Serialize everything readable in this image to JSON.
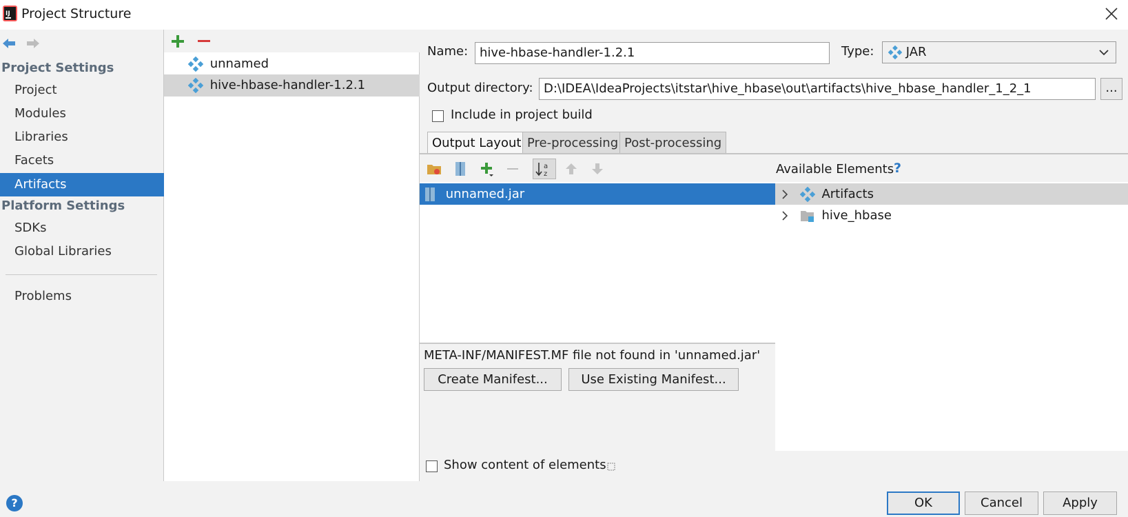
{
  "window": {
    "title": "Project Structure"
  },
  "sidebar": {
    "project_settings_header": "Project Settings",
    "project_items": [
      "Project",
      "Modules",
      "Libraries",
      "Facets",
      "Artifacts"
    ],
    "platform_settings_header": "Platform Settings",
    "platform_items": [
      "SDKs",
      "Global Libraries"
    ],
    "problems_label": "Problems",
    "selected": "Artifacts"
  },
  "artifacts_list": {
    "items": [
      "unnamed",
      "hive-hbase-handler-1.2.1"
    ],
    "selected": "hive-hbase-handler-1.2.1"
  },
  "form": {
    "name_label": "Name:",
    "name_value": "hive-hbase-handler-1.2.1",
    "type_label": "Type:",
    "type_value": "JAR",
    "output_dir_label": "Output directory:",
    "output_dir_value": "D:\\IDEA\\IdeaProjects\\itstar\\hive_hbase\\out\\artifacts\\hive_hbase_handler_1_2_1",
    "browse_label": "...",
    "include_label": "Include in project build",
    "include_checked": false
  },
  "tabs": [
    "Output Layout",
    "Pre-processing",
    "Post-processing"
  ],
  "active_tab": "Output Layout",
  "output_layout": {
    "root_item": "unnamed.jar",
    "available_header": "Available Elements",
    "available_help": "?",
    "available_items": [
      "Artifacts",
      "hive_hbase"
    ],
    "manifest_message": "META-INF/MANIFEST.MF file not found in 'unnamed.jar'",
    "create_manifest_label": "Create Manifest...",
    "use_existing_label": "Use Existing Manifest...",
    "show_content_label": "Show content of elements",
    "show_content_checked": false
  },
  "footer": {
    "help": "?",
    "ok_label": "OK",
    "cancel_label": "Cancel",
    "apply_label": "Apply"
  },
  "colors": {
    "selection_blue": "#2b78c5",
    "section_header": "#5c6b7a",
    "add_green": "#3a9a3a",
    "remove_red": "#d63b3b",
    "artifact_diamond": "#4a9fd6"
  }
}
